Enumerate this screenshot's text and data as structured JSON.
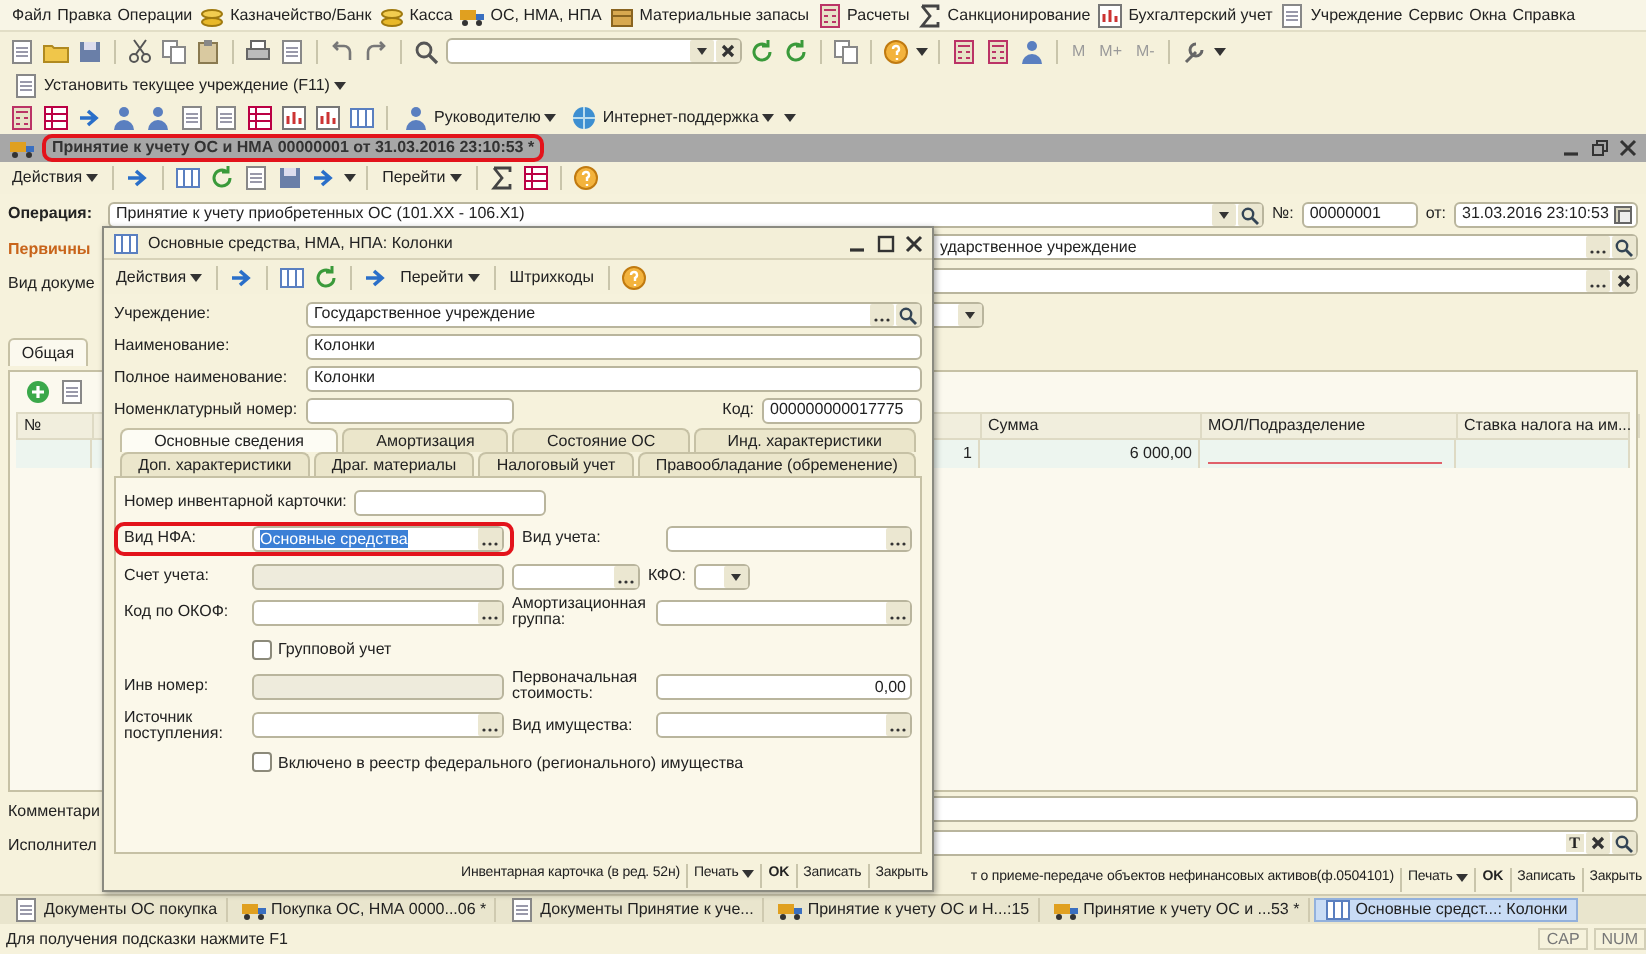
{
  "menu": [
    {
      "label": "Файл",
      "kind": "plain"
    },
    {
      "label": "Правка",
      "kind": "plain"
    },
    {
      "label": "Операции",
      "kind": "plain"
    },
    {
      "label": "Казначейство/Банк",
      "kind": "icon"
    },
    {
      "label": "Касса",
      "kind": "icon"
    },
    {
      "label": "ОС, НМА, НПА",
      "kind": "icon"
    },
    {
      "label": "Материальные запасы",
      "kind": "icon"
    },
    {
      "label": "Расчеты",
      "kind": "icon"
    },
    {
      "label": "Санкционирование",
      "kind": "icon"
    },
    {
      "label": "Бухгалтерский учет",
      "kind": "icon"
    },
    {
      "label": "Учреждение",
      "kind": "icon"
    },
    {
      "label": "Сервис",
      "kind": "plain"
    },
    {
      "label": "Окна",
      "kind": "plain"
    },
    {
      "label": "Справка",
      "kind": "plain"
    }
  ],
  "toolbar_main": {
    "memory_buttons": [
      {
        "label": "M",
        "disabled": true
      },
      {
        "label": "M+",
        "disabled": true
      },
      {
        "label": "M-",
        "disabled": true
      }
    ]
  },
  "toolbar_institution": {
    "button": "Установить текущее учреждение (F11)"
  },
  "toolbar_reports": {
    "buttons": [
      "Руководителю",
      "Интернет-поддержка"
    ]
  },
  "document": {
    "title": "Принятие к учету ОС и НМА 00000001 от 31.03.2016 23:10:53 *",
    "highlighted": true,
    "toolbar": [
      {
        "label": "Действия",
        "kind": "menu"
      },
      {
        "label": "Перейти",
        "kind": "menu"
      }
    ],
    "operation_label": "Операция:",
    "operation": "Принятие к учету приобретенных ОС (101.XX - 106.X1)",
    "number_label": "№:",
    "number": "00000001",
    "date_label": "от:",
    "date": "31.03.2016 23:10:53",
    "section_link": "Первичны",
    "doc_kind_label": "Вид докуме",
    "institution": "ударственное учреждение",
    "tab": {
      "label": "Общая",
      "selected": true
    },
    "table": {
      "columns": [
        {
          "heading": "№"
        },
        {
          "heading": "Сумма"
        },
        {
          "heading": "МОЛ/Подразделение"
        },
        {
          "heading": "Ставка налога на им..."
        }
      ],
      "rows": [
        {
          "column_2": "1",
          "sum": "6 000,00",
          "mol_required": true
        }
      ]
    },
    "comment_label": "Комментари",
    "executor_label": "Исполнител",
    "executor_text_button": "T",
    "bottom_bar": [
      {
        "label": "т о приеме-передаче объектов нефинансовых активов(ф.0504101)",
        "kind": "plain"
      },
      {
        "label": "Печать",
        "kind": "menu"
      },
      {
        "label": "OK",
        "kind": "default"
      },
      {
        "label": "Записать",
        "kind": "plain"
      },
      {
        "label": "Закрыть",
        "kind": "plain"
      }
    ]
  },
  "dialog": {
    "title": "Основные средства, НМА, НПА: Колонки",
    "toolbar": [
      {
        "label": "Действия",
        "kind": "menu"
      },
      {
        "label": "Перейти",
        "kind": "menu"
      },
      {
        "label": "Штрихкоды",
        "kind": "plain"
      }
    ],
    "institution_label": "Учреждение:",
    "institution": "Государственное учреждение",
    "name_label": "Наименование:",
    "name": "Колонки",
    "full_name_label": "Полное наименование:",
    "full_name": "Колонки",
    "nomenclature_label": "Номенклатурный номер:",
    "code_label": "Код:",
    "code": "000000000017775",
    "tab_rows": [
      {
        "tabs": [
          {
            "label": "Основные сведения",
            "selected": true
          },
          {
            "label": "Амортизация",
            "selected": false
          },
          {
            "label": "Состояние ОС",
            "selected": false
          },
          {
            "label": "Инд. характеристики",
            "selected": false
          }
        ]
      },
      {
        "tabs": [
          {
            "label": "Доп. характеристики",
            "selected": false
          },
          {
            "label": "Драг. материалы",
            "selected": false
          },
          {
            "label": "Налоговый учет",
            "selected": false
          },
          {
            "label": "Правообладание (обременение)",
            "selected": false
          }
        ]
      }
    ],
    "form": {
      "inventory_card_label": "Номер инвентарной карточки:",
      "nfa_kind_label": "Вид НФА:",
      "nfa_kind": "Основные средства",
      "nfa_kind_text_selected": true,
      "nfa_kind_highlighted": true,
      "accounting_kind_label": "Вид учета:",
      "account_label": "Счет учета:",
      "account_disabled": true,
      "kfo_label": "КФО:",
      "okof_label": "Код по ОКОФ:",
      "depreciation_group_label": "Амортизационная группа:",
      "group_accounting": {
        "label": "Групповой учет",
        "checked": false
      },
      "inventory_number_label": "Инв номер:",
      "inventory_number_disabled": true,
      "initial_cost_label": "Первоначальная стоимость:",
      "initial_cost": "0,00",
      "source_label": "Источник поступления:",
      "property_kind_label": "Вид имущества:",
      "registry": {
        "label": "Включено в реестр федерального (регионального) имущества",
        "checked": false
      }
    },
    "bottom_bar": [
      {
        "label": "Инвентарная карточка (в ред. 52н)",
        "kind": "plain"
      },
      {
        "label": "Печать",
        "kind": "menu"
      },
      {
        "label": "OK",
        "kind": "default"
      },
      {
        "label": "Записать",
        "kind": "plain"
      },
      {
        "label": "Закрыть",
        "kind": "plain"
      }
    ]
  },
  "taskbar": [
    {
      "label": "Документы ОС покупка",
      "kind": "list",
      "selected": false
    },
    {
      "label": "Покупка ОС, НМА 0000...06 *",
      "kind": "document",
      "selected": false
    },
    {
      "label": "Документы Принятие к уче...",
      "kind": "list",
      "selected": false
    },
    {
      "label": "Принятие к учету ОС и Н...:15",
      "kind": "document",
      "selected": false
    },
    {
      "label": "Принятие к учету ОС и ...53 *",
      "kind": "document",
      "selected": false
    },
    {
      "label": "Основные средст...: Колонки",
      "kind": "catalog",
      "selected": true
    }
  ],
  "status_bar": {
    "hint": "Для получения подсказки нажмите F1",
    "indicators": [
      "CAP",
      "NUM"
    ]
  }
}
